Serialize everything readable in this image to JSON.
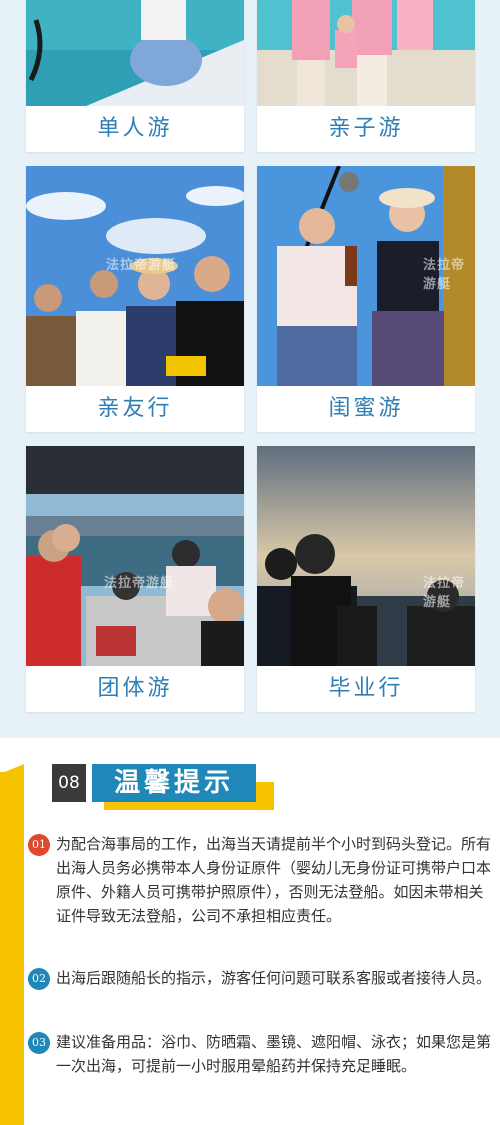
{
  "cards": [
    {
      "label": "单人游",
      "icon": "solo-trip-photo"
    },
    {
      "label": "亲子游",
      "icon": "family-trip-photo"
    },
    {
      "label": "亲友行",
      "icon": "friends-trip-photo"
    },
    {
      "label": "闺蜜游",
      "icon": "girlfriends-trip-photo"
    },
    {
      "label": "团体游",
      "icon": "group-trip-photo"
    },
    {
      "label": "毕业行",
      "icon": "graduation-trip-photo"
    }
  ],
  "watermark": "法拉帝游艇",
  "tips": {
    "number": "08",
    "title": "温馨提示",
    "items": [
      {
        "badge": "01",
        "text": "为配合海事局的工作，出海当天请提前半个小时到码头登记。所有出海人员务必携带本人身份证原件（婴幼儿无身份证可携带户口本原件、外籍人员可携带护照原件），否则无法登船。如因未带相关证件导致无法登船，公司不承担相应责任。"
      },
      {
        "badge": "02",
        "text": "出海后跟随船长的指示，游客任何问题可联系客服或者接待人员。"
      },
      {
        "badge": "03",
        "text": "建议准备用品：浴巾、防晒霜、墨镜、遮阳帽、泳衣；如果您是第一次出海，可提前一小时服用晕船药并保持充足睡眠。"
      }
    ]
  },
  "colors": {
    "accent": "#1f88b8",
    "yellow": "#f7c200",
    "badge_red": "#e0472b",
    "badge_blue": "#1f88b8",
    "label_blue": "#2f7fb5"
  }
}
